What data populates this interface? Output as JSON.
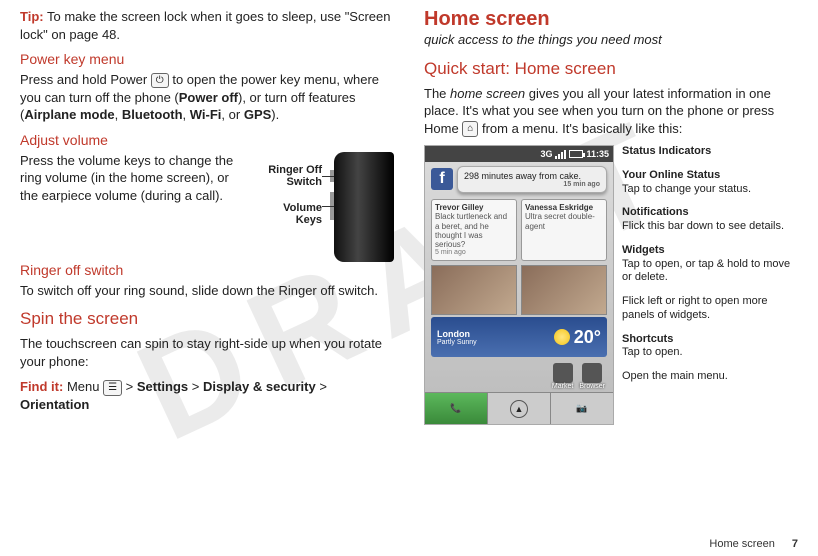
{
  "watermark": "DRAFT",
  "left": {
    "tip_label": "Tip:",
    "tip_text": " To make the screen lock when it goes to sleep, use \"Screen lock\" on page 48.",
    "power_menu_h": "Power key menu",
    "power_menu_p1a": "Press and hold Power ",
    "power_menu_p1b": " to open the power key menu, where you can turn off the phone (",
    "power_off": "Power off",
    "power_menu_p1c": "), or turn off features (",
    "airplane": "Airplane mode",
    "bluetooth": "Bluetooth",
    "wifi": "Wi-Fi",
    "gps": "GPS",
    "power_menu_p1d": ").",
    "adjust_vol_h": "Adjust volume",
    "adjust_vol_p": "Press the volume keys to change the ring volume (in the home screen), or the earpiece volume (during a call).",
    "ringer_off_label": "Ringer Off Switch",
    "volume_keys_label": "Volume Keys",
    "ringer_switch_h": "Ringer off switch",
    "ringer_switch_p": "To switch off your ring sound, slide down the Ringer off switch.",
    "spin_h": "Spin the screen",
    "spin_p": "The touchscreen can spin to stay right-side up when you rotate your phone:",
    "find_it": "Find it:",
    "find_it_menu": " Menu ",
    "settings": "Settings",
    "display_sec": "Display & security",
    "orientation": "Orientation",
    "gt": " > ",
    "comma": ", ",
    "or": ", or "
  },
  "right": {
    "title": "Home screen",
    "subtitle": "quick access to the things you need most",
    "qs_h": "Quick start: Home screen",
    "qs_p1a": "The ",
    "qs_p1b": "home screen",
    "qs_p1c": " gives you all your latest information in one place. It's what you see when you turn on the phone or press Home ",
    "qs_p1d": " from a menu. It's basically like this:",
    "status": {
      "net": "3G",
      "time": "11:35"
    },
    "notif": {
      "text": "298 minutes away from cake.",
      "age": "15 min ago"
    },
    "w1": {
      "name": "Trevor Gilley",
      "sub": "Black turtleneck and a beret, and he thought I was serious?",
      "age": "5 min ago"
    },
    "w2": {
      "name": "Vanessa Eskridge",
      "sub": "Ultra secret double-agent"
    },
    "weather": {
      "city": "London",
      "cond": "Partly Sunny",
      "temp": "20°"
    },
    "shortcuts": {
      "a": "Market",
      "b": "Browser"
    },
    "callouts": {
      "c1t": "Status Indicators",
      "c2t": "Your Online Status",
      "c2s": "Tap to change your status.",
      "c3t": "Notifications",
      "c3s": "Flick this bar down to see details.",
      "c4t": "Widgets",
      "c4s": "Tap to open, or tap & hold to move or delete.",
      "c5s": "Flick left or right to open more panels of widgets.",
      "c6t": "Shortcuts",
      "c6s": "Tap to open.",
      "c7s": "Open the main menu."
    }
  },
  "footer": {
    "section": "Home screen",
    "page": "7"
  },
  "icons": {
    "power": "⏻",
    "home": "⌂",
    "menu": "☰",
    "phone": "📞",
    "apps": "▲",
    "cam": "📷"
  }
}
